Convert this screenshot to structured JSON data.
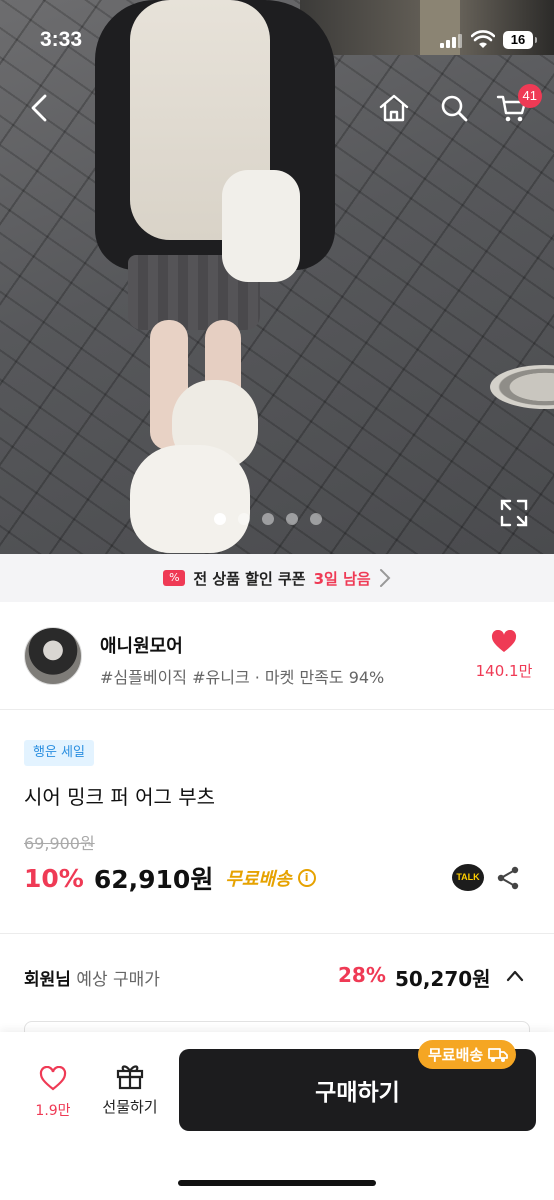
{
  "status_bar": {
    "time": "3:33",
    "battery": "16"
  },
  "nav": {
    "cart_count": "41"
  },
  "carousel": {
    "total": 5,
    "active_index": 0
  },
  "coupon": {
    "text": "전 상품 할인 쿠폰",
    "days_left": "3일 남음"
  },
  "store": {
    "name": "애니원모어",
    "tags": "#심플베이직 #유니크 · 마켓 만족도 94%",
    "likes": "140.1만"
  },
  "product": {
    "badge": "행운 세일",
    "title": "시어 밍크 퍼 어그 부츠",
    "original_price": "69,900원",
    "discount": "10%",
    "price": "62,910원",
    "shipping": "무료배송",
    "talk_label": "TALK"
  },
  "member_price": {
    "label_bold": "회원님",
    "label_rest": " 예상 구매가",
    "discount": "28%",
    "price": "50,270원"
  },
  "bottom_bar": {
    "likes": "1.9만",
    "gift_label": "선물하기",
    "buy_label": "구매하기",
    "free_ship_badge": "무료배송"
  },
  "colors": {
    "accent_red": "#ef3a55",
    "shipping_orange": "#e6a200",
    "buy_button": "#1c1c1e"
  }
}
